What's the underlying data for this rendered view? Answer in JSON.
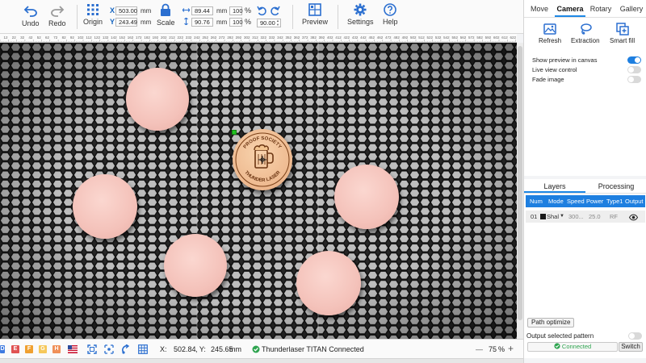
{
  "toolbar": {
    "undo": "Undo",
    "redo": "Redo",
    "origin": "Origin",
    "scale": "Scale",
    "preview": "Preview",
    "settings": "Settings",
    "help": "Help",
    "x_label": "X",
    "x_value": "503.00",
    "y_label": "Y",
    "y_value": "243.49",
    "unit_mm": "mm",
    "width_value": "89.44",
    "width_pct": "100",
    "height_value": "90.76",
    "height_pct": "100",
    "pct_sign": "%",
    "rotation_value": "90.00"
  },
  "ruler": {
    "labels": [
      "12",
      "22",
      "32",
      "42",
      "52",
      "62",
      "72",
      "82",
      "92",
      "102",
      "112",
      "122",
      "132",
      "142",
      "152",
      "162",
      "172",
      "182",
      "192",
      "202",
      "212",
      "222",
      "232",
      "242",
      "252",
      "262",
      "272",
      "282",
      "292",
      "302",
      "312",
      "322",
      "332",
      "342",
      "352",
      "362",
      "372",
      "382",
      "392",
      "402",
      "412",
      "422",
      "432",
      "442",
      "452",
      "462",
      "472",
      "482",
      "492",
      "502",
      "512",
      "522",
      "532",
      "542",
      "552",
      "562",
      "572",
      "582",
      "592",
      "602",
      "612",
      "622",
      "632"
    ]
  },
  "status": {
    "chips": [
      {
        "letter": "D",
        "color": "#3f7be0"
      },
      {
        "letter": "E",
        "color": "#e05252"
      },
      {
        "letter": "F",
        "color": "#f0a030"
      },
      {
        "letter": "G",
        "color": "#f6c85a"
      },
      {
        "letter": "H",
        "color": "#f09058"
      }
    ],
    "x_label": "X:",
    "x_value": "502.84",
    "y_label": ", Y:",
    "y_value": "245.65",
    "unit": "mm",
    "connection": "Thunderlaser TITAN Connected",
    "zoom_minus": "—",
    "zoom_value": "75",
    "zoom_pct": "%",
    "zoom_plus": "+"
  },
  "right_tabs": [
    "Move",
    "Camera",
    "Rotary",
    "Gallery"
  ],
  "camera": {
    "refresh": "Refresh",
    "extraction": "Extraction",
    "smart_fill": "Smart fill",
    "options": [
      {
        "label": "Show preview in canvas",
        "on": true
      },
      {
        "label": "Live view control",
        "on": false
      },
      {
        "label": "Fade image",
        "on": false
      }
    ]
  },
  "layers": {
    "tabs": [
      "Layers",
      "Processing"
    ],
    "columns": [
      "Num",
      "Mode",
      "Speed",
      "Power",
      "Type1",
      "Output"
    ],
    "row": {
      "num": "01",
      "mode": "Shal",
      "speed": "300...",
      "power": "25.0",
      "type": "RF"
    },
    "path_optimize": "Path optimize",
    "output_selected": "Output selected pattern",
    "connected": "Connected",
    "switch": "Switch"
  },
  "coaster": {
    "top_text": "PROOF SOCIETY",
    "bottom_text": "THUNDER LASER"
  },
  "colors": {
    "accent": "#1e7fe0",
    "chip_blue": "#3f7be0",
    "connected_green": "#2ea44f"
  }
}
